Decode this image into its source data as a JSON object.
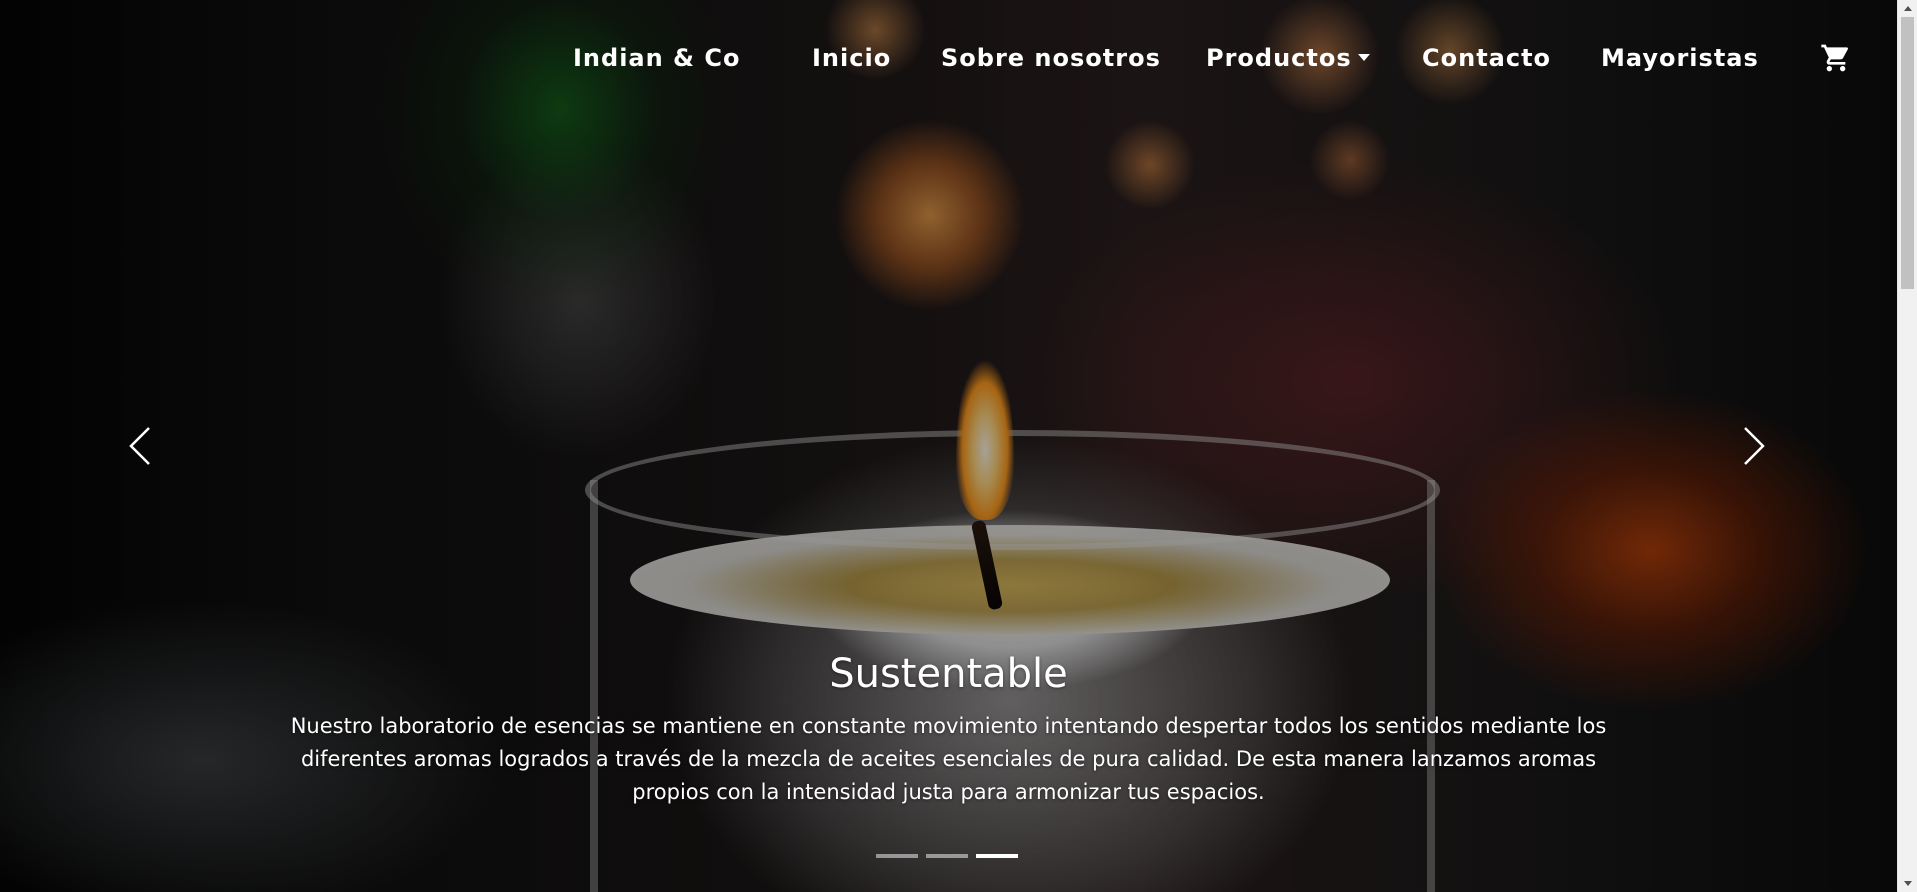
{
  "navbar": {
    "brand": "Indian & Co",
    "items": [
      {
        "label": "Inicio"
      },
      {
        "label": "Sobre nosotros"
      },
      {
        "label": "Productos"
      },
      {
        "label": "Contacto"
      },
      {
        "label": "Mayoristas"
      }
    ],
    "cart_icon": "shopping-cart-icon"
  },
  "hero": {
    "slide_title": "Sustentable",
    "slide_text": "Nuestro laboratorio de esencias se mantiene en constante movimiento intentando despertar todos los sentidos mediante los diferentes aromas logrados a través de la mezcla de aceites esenciales de pura calidad. De esta manera lanzamos aromas propios con la intensidad justa para armonizar tus espacios.",
    "slide_count": 3,
    "active_slide": 3,
    "prev_icon": "chevron-left-icon",
    "next_icon": "chevron-right-icon"
  },
  "colors": {
    "nav_text": "#ffffff",
    "indicator_active": "#ffffff",
    "indicator_inactive": "#9a9a9a"
  }
}
